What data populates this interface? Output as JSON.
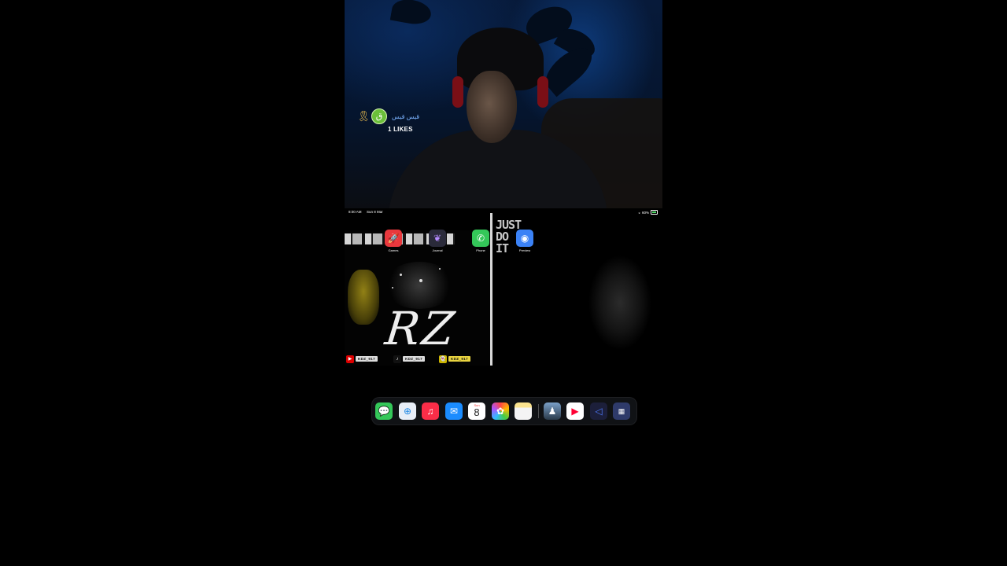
{
  "video": {
    "gift_user": "قيس قيس",
    "gift_avatar_letter": "ق",
    "likes_text": "1 LIKES"
  },
  "status_bar": {
    "time": "8:00 AM",
    "date": "Sun 8 Mar",
    "battery": "60%"
  },
  "widget": {
    "logo": "RZ",
    "tagline": "JUST\nDO\nIT",
    "socials": [
      {
        "icon": "youtube-icon",
        "handle": "KDZ_917"
      },
      {
        "icon": "tiktok-icon",
        "handle": "KDZ_917"
      },
      {
        "icon": "snapchat-icon",
        "handle": "KDZ_917"
      }
    ]
  },
  "apps": [
    {
      "name": "Games",
      "icon": "rocket-icon",
      "color": "#e8383d"
    },
    {
      "name": "Journal",
      "icon": "butterfly-icon",
      "color": "#2a2a3a"
    },
    {
      "name": "Phone",
      "icon": "phone-icon",
      "color": "#34c759"
    },
    {
      "name": "Preview",
      "icon": "preview-icon",
      "color": "#3b82f6"
    }
  ],
  "dock": {
    "calendar_day": "Sun",
    "calendar_date": "8",
    "apps": [
      {
        "name": "Messages",
        "icon": "messages-icon",
        "color": "#34c759"
      },
      {
        "name": "Safari",
        "icon": "safari-icon",
        "color": "#1e88e5"
      },
      {
        "name": "Music",
        "icon": "music-icon",
        "color": "#fa2d48"
      },
      {
        "name": "Mail",
        "icon": "mail-icon",
        "color": "#1a8cff"
      },
      {
        "name": "Calendar",
        "icon": "calendar-icon",
        "color": "#ffffff"
      },
      {
        "name": "Photos",
        "icon": "photos-icon",
        "color": "#ffffff"
      },
      {
        "name": "Notes",
        "icon": "notes-icon",
        "color": "#fbe38e"
      },
      {
        "name": "Game",
        "icon": "game-icon",
        "color": "#3a4a5a"
      },
      {
        "name": "YouTube",
        "icon": "youtube-icon",
        "color": "#ff0033"
      },
      {
        "name": "VN",
        "icon": "vn-icon",
        "color": "#1c1f3a"
      },
      {
        "name": "App Library",
        "icon": "app-library-icon",
        "color": "#2e3a6a"
      }
    ]
  }
}
